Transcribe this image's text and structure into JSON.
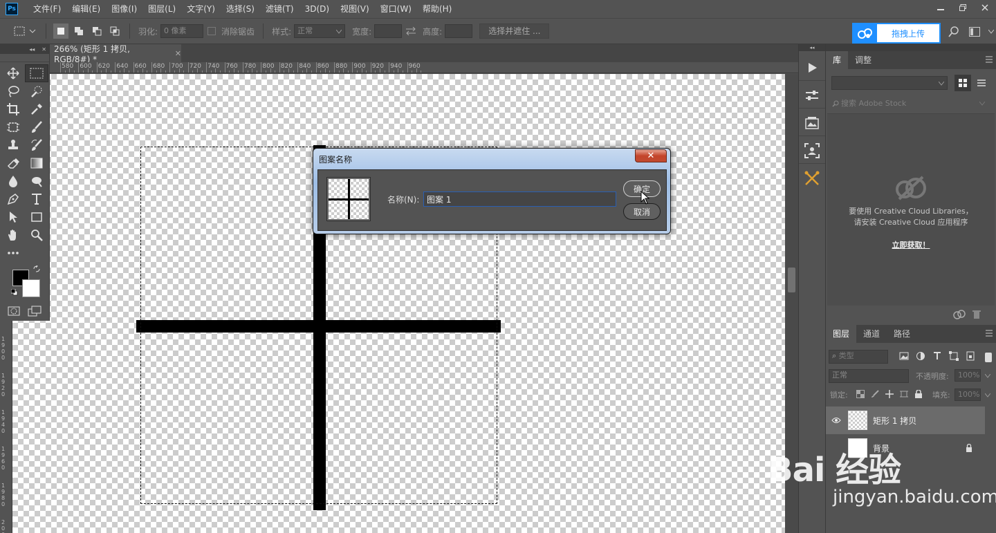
{
  "app": {
    "logo": "Ps",
    "menu": [
      "文件(F)",
      "编辑(E)",
      "图像(I)",
      "图层(L)",
      "文字(Y)",
      "选择(S)",
      "滤镜(T)",
      "3D(D)",
      "视图(V)",
      "窗口(W)",
      "帮助(H)"
    ]
  },
  "options": {
    "feather_label": "羽化:",
    "feather_value": "0 像素",
    "antialias_label": "消除锯齿",
    "style_label": "样式:",
    "style_value": "正常",
    "width_label": "宽度:",
    "height_label": "高度:",
    "select_mask_label": "选择并遮住 ...",
    "upload_label": "拖拽上传"
  },
  "document": {
    "tab_title": "266% (矩形 1 拷贝, RGB/8#) *",
    "ruler_h": [
      "580",
      "600",
      "620",
      "640",
      "660",
      "680",
      "700",
      "720",
      "740",
      "760",
      "780",
      "800",
      "820",
      "840",
      "860",
      "880",
      "900",
      "920",
      "940",
      "960"
    ],
    "ruler_v": [
      "1900",
      "1920",
      "1940",
      "1960",
      "1980",
      "2000"
    ]
  },
  "dialog": {
    "title": "图案名称",
    "name_label": "名称(N):",
    "name_value": "图案 1",
    "ok_label": "确定",
    "cancel_label": "取消"
  },
  "library_panel": {
    "tabs": [
      "库",
      "调整"
    ],
    "search_placeholder": "搜索 Adobe Stock",
    "message_line1": "要使用 Creative Cloud Libraries，",
    "message_line2": "请安装 Creative Cloud 应用程序",
    "get_link": "立即获取！"
  },
  "layers_panel": {
    "tabs": [
      "图层",
      "通道",
      "路径"
    ],
    "filter_label": "类型",
    "blend_mode": "正常",
    "opacity_label": "不透明度:",
    "opacity_value": "100%",
    "lock_label": "锁定:",
    "fill_label": "填充:",
    "fill_value": "100%",
    "layers": [
      {
        "name": "矩形 1 拷贝"
      },
      {
        "name": "背景"
      }
    ]
  },
  "watermark": {
    "brand": "Bai 经验",
    "url": "jingyan.baidu.com"
  },
  "colors": {
    "accent_blue": "#1f8fff",
    "foreground": "#000000",
    "background": "#ffffff"
  }
}
